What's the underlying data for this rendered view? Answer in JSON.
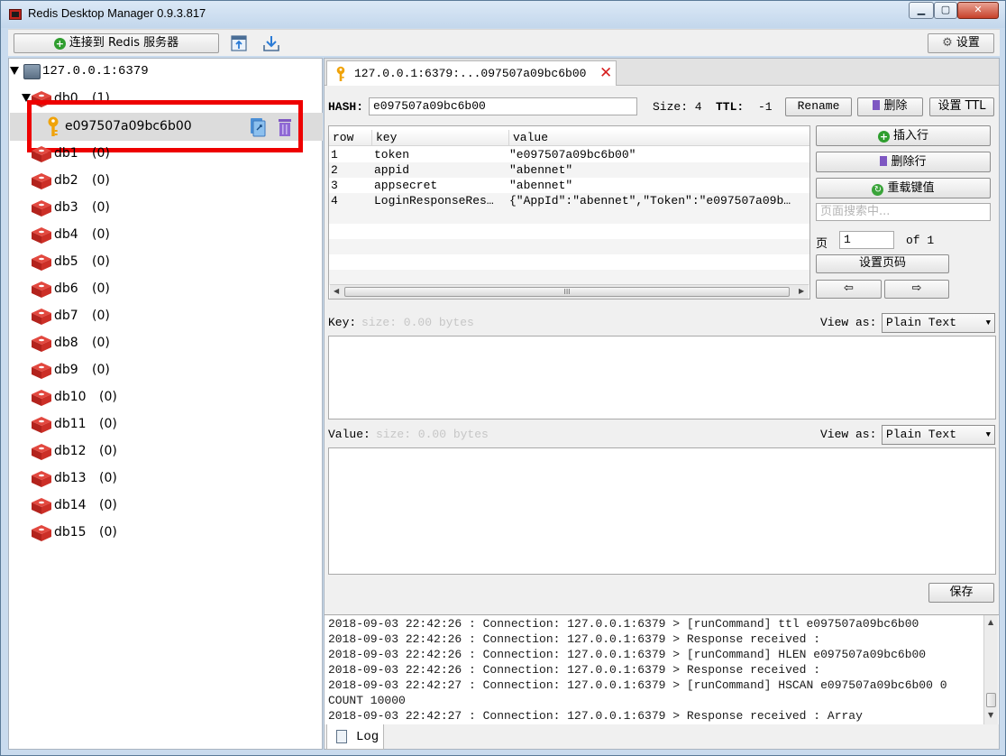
{
  "window": {
    "title": "Redis Desktop Manager 0.9.3.817"
  },
  "toolbar": {
    "connect_label": "连接到 Redis 服务器",
    "settings_label": "设置"
  },
  "tree": {
    "server": "127.0.0.1:6379",
    "db0": {
      "name": "db0",
      "count": "(1)"
    },
    "key": "e097507a09bc6b00",
    "databases": [
      {
        "name": "db1",
        "count": "(0)"
      },
      {
        "name": "db2",
        "count": "(0)"
      },
      {
        "name": "db3",
        "count": "(0)"
      },
      {
        "name": "db4",
        "count": "(0)"
      },
      {
        "name": "db5",
        "count": "(0)"
      },
      {
        "name": "db6",
        "count": "(0)"
      },
      {
        "name": "db7",
        "count": "(0)"
      },
      {
        "name": "db8",
        "count": "(0)"
      },
      {
        "name": "db9",
        "count": "(0)"
      },
      {
        "name": "db10",
        "count": "(0)"
      },
      {
        "name": "db11",
        "count": "(0)"
      },
      {
        "name": "db12",
        "count": "(0)"
      },
      {
        "name": "db13",
        "count": "(0)"
      },
      {
        "name": "db14",
        "count": "(0)"
      },
      {
        "name": "db15",
        "count": "(0)"
      }
    ]
  },
  "tab": {
    "title": "127.0.0.1:6379:...097507a09bc6b00"
  },
  "key_info": {
    "type_label": "HASH:",
    "key_name": "e097507a09bc6b00",
    "size": "Size: 4",
    "ttl_label": "TTL:",
    "ttl_value": "-1",
    "rename": "Rename",
    "delete": "删除",
    "set_ttl": "设置 TTL"
  },
  "table": {
    "headers": [
      "row",
      "key",
      "value"
    ],
    "rows": [
      [
        "1",
        "token",
        "\"e097507a09bc6b00\""
      ],
      [
        "2",
        "appid",
        "\"abennet\""
      ],
      [
        "3",
        "appsecret",
        "\"abennet\""
      ],
      [
        "4",
        "LoginResponseRes…",
        "{\"AppId\":\"abennet\",\"Token\":\"e097507a09b…"
      ]
    ],
    "scroll_grip": "III"
  },
  "side_controls": {
    "insert_row": "插入行",
    "delete_row": "删除行",
    "reload": "重载键值",
    "search_placeholder": "页面搜索中...",
    "page_label": "页",
    "page_value": "1",
    "page_of": "of 1",
    "set_page": "设置页码",
    "prev": "⇦",
    "next": "⇨"
  },
  "key_editor": {
    "label": "Key:",
    "size": "size: 0.00 bytes",
    "view_as": "View as:",
    "mode": "Plain Text"
  },
  "value_editor": {
    "label": "Value:",
    "size": "size: 0.00 bytes",
    "view_as": "View as:",
    "mode": "Plain Text"
  },
  "save_label": "保存",
  "log": {
    "tab_label": "Log",
    "lines": [
      "2018-09-03 22:42:26 : Connection: 127.0.0.1:6379 > [runCommand] ttl e097507a09bc6b00",
      "2018-09-03 22:42:26 : Connection: 127.0.0.1:6379 > Response received :",
      "2018-09-03 22:42:26 : Connection: 127.0.0.1:6379 > [runCommand] HLEN e097507a09bc6b00",
      "2018-09-03 22:42:26 : Connection: 127.0.0.1:6379 > Response received :",
      "2018-09-03 22:42:27 : Connection: 127.0.0.1:6379 > [runCommand] HSCAN e097507a09bc6b00 0",
      "COUNT 10000",
      "2018-09-03 22:42:27 : Connection: 127.0.0.1:6379 > Response received : Array"
    ]
  },
  "colors": {
    "highlight": "#ee0000",
    "db_icon": "#d0312d",
    "key_icon": "#f0a30a",
    "trash": "#7e57c2"
  }
}
